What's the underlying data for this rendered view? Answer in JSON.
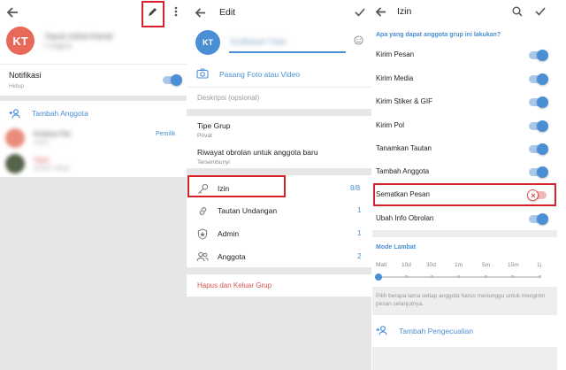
{
  "colors": {
    "accent": "#4a8fd4",
    "avatar": "#e8685a",
    "danger": "#d9534f",
    "highlight": "#d8202a"
  },
  "panel1": {
    "avatar_initials": "KT",
    "group_name_blurred": "Yayuk Indria Kamal",
    "group_status_blurred": "2 anggota",
    "notifications_label": "Notifikasi",
    "notifications_status": "Hidup",
    "add_member_label": "Tambah Anggota",
    "owner_badge": "Pemilik",
    "members": [
      {
        "name": "Kristina Fitri",
        "status": "online"
      },
      {
        "name": "Agus",
        "status": "terakhir dilihat"
      }
    ]
  },
  "panel2": {
    "title": "Edit",
    "avatar_initials": "KT",
    "group_name_blurred": "Kurikulum Tutor",
    "set_photo_label": "Pasang Foto atau Video",
    "description_placeholder": "Deskripsi (opsional)",
    "group_type_label": "Tipe Grup",
    "group_type_value": "Privat",
    "history_label": "Riwayat obrolan untuk anggota baru",
    "history_value": "Tersembunyi",
    "items": [
      {
        "label": "Izin",
        "value": "8/8"
      },
      {
        "label": "Tautan Undangan",
        "value": "1"
      },
      {
        "label": "Admin",
        "value": "1"
      },
      {
        "label": "Anggota",
        "value": "2"
      }
    ],
    "delete_label": "Hapus dan Keluar Grup"
  },
  "panel3": {
    "title": "Izin",
    "question": "Apa yang dapat anggota grup ini lakukan?",
    "permissions": [
      {
        "label": "Kirim Pesan",
        "on": true
      },
      {
        "label": "Kirim Media",
        "on": true
      },
      {
        "label": "Kirim Stiker & GIF",
        "on": true
      },
      {
        "label": "Kirim Pol",
        "on": true
      },
      {
        "label": "Tanamkan Tautan",
        "on": true
      },
      {
        "label": "Tambah Anggota",
        "on": true
      },
      {
        "label": "Sematkan Pesan",
        "on": false
      },
      {
        "label": "Ubah Info Obrolan",
        "on": true
      }
    ],
    "slow_mode_label": "Mode Lambat",
    "slow_mode_ticks": [
      "Mati",
      "10d",
      "30d",
      "1m",
      "5m",
      "15m",
      "1j"
    ],
    "slow_mode_selected": "Mati",
    "slow_mode_hint": "Pilih berapa lama setiap anggota harus menunggu untuk mengirim pesan selanjutnya.",
    "add_exception_label": "Tambah Pengecualian"
  }
}
